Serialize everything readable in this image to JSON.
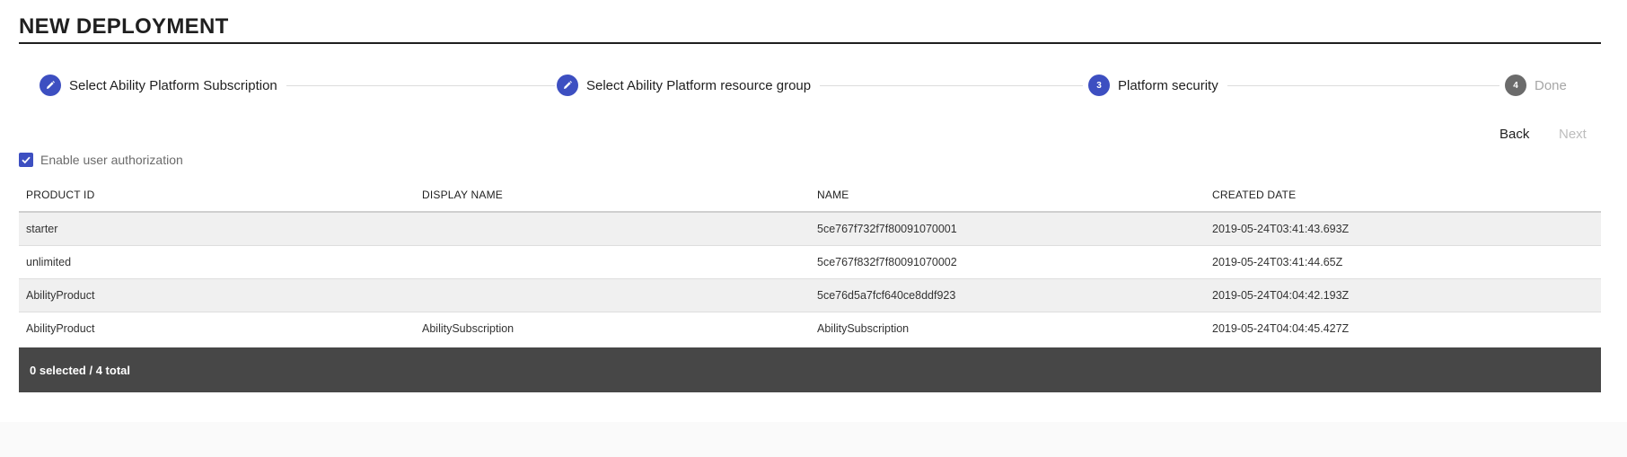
{
  "page": {
    "title": "NEW DEPLOYMENT"
  },
  "stepper": {
    "steps": [
      {
        "number": "1",
        "label": "Select Ability Platform Subscription",
        "state": "completed",
        "icon": "pencil-icon"
      },
      {
        "number": "2",
        "label": "Select Ability Platform resource group",
        "state": "completed",
        "icon": "pencil-icon"
      },
      {
        "number": "3",
        "label": "Platform security",
        "state": "current"
      },
      {
        "number": "4",
        "label": "Done",
        "state": "todo"
      }
    ]
  },
  "nav": {
    "back_label": "Back",
    "next_label": "Next"
  },
  "auth": {
    "label": "Enable user authorization",
    "checked": true
  },
  "table": {
    "columns": [
      "PRODUCT ID",
      "DISPLAY NAME",
      "NAME",
      "CREATED DATE"
    ],
    "rows": [
      {
        "product_id": "starter",
        "display_name": "",
        "name": "5ce767f732f7f80091070001",
        "created_date": "2019-05-24T03:41:43.693Z"
      },
      {
        "product_id": "unlimited",
        "display_name": "",
        "name": "5ce767f832f7f80091070002",
        "created_date": "2019-05-24T03:41:44.65Z"
      },
      {
        "product_id": "AbilityProduct",
        "display_name": "",
        "name": "5ce76d5a7fcf640ce8ddf923",
        "created_date": "2019-05-24T04:04:42.193Z"
      },
      {
        "product_id": "AbilityProduct",
        "display_name": "AbilitySubscription",
        "name": "AbilitySubscription",
        "created_date": "2019-05-24T04:04:45.427Z"
      }
    ],
    "footer": "0 selected / 4 total"
  },
  "colors": {
    "accent": "#3d4fc1",
    "footer_bg": "#474747",
    "step_todo": "#6b6b6b"
  }
}
